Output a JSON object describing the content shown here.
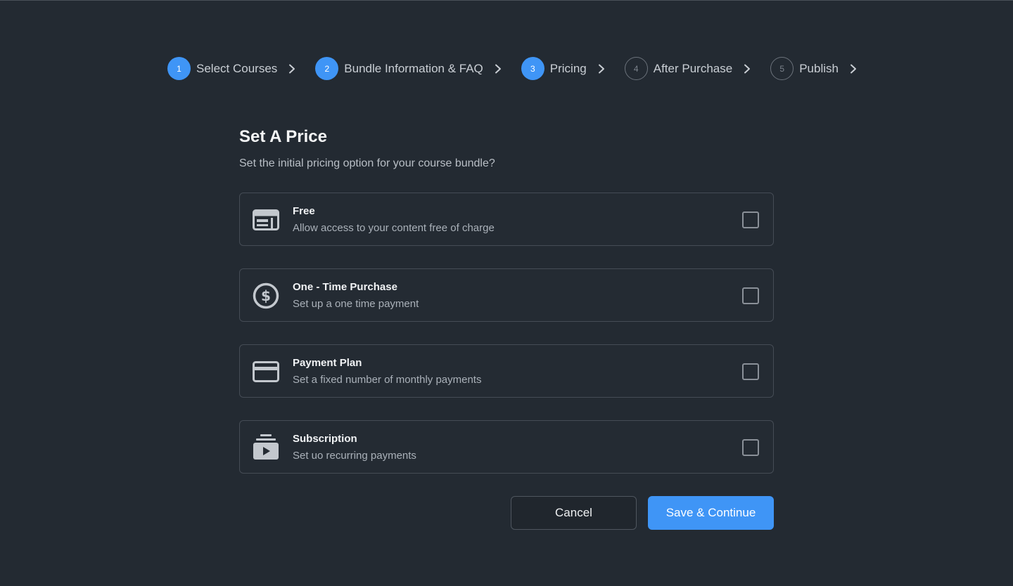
{
  "stepper": {
    "steps": [
      {
        "number": "1",
        "label": "Select Courses",
        "state": "active"
      },
      {
        "number": "2",
        "label": "Bundle Information & FAQ",
        "state": "active"
      },
      {
        "number": "3",
        "label": "Pricing",
        "state": "active"
      },
      {
        "number": "4",
        "label": "After Purchase",
        "state": "inactive"
      },
      {
        "number": "5",
        "label": "Publish",
        "state": "inactive"
      }
    ]
  },
  "page": {
    "title": "Set A Price",
    "subtitle": "Set the initial pricing option for your course bundle?"
  },
  "options": [
    {
      "icon": "layout-icon",
      "title": "Free",
      "description": "Allow access to your content free of charge",
      "checked": false
    },
    {
      "icon": "dollar-circle-icon",
      "title": "One - Time Purchase",
      "description": "Set up a one time payment",
      "checked": false
    },
    {
      "icon": "credit-card-icon",
      "title": "Payment Plan",
      "description": "Set a fixed number of monthly payments",
      "checked": false
    },
    {
      "icon": "subscription-icon",
      "title": "Subscription",
      "description": "Set uo recurring payments",
      "checked": false
    }
  ],
  "actions": {
    "cancel_label": "Cancel",
    "save_label": "Save & Continue"
  },
  "colors": {
    "background": "#232a32",
    "accent": "#3f95f6",
    "card_border": "#454c55"
  }
}
